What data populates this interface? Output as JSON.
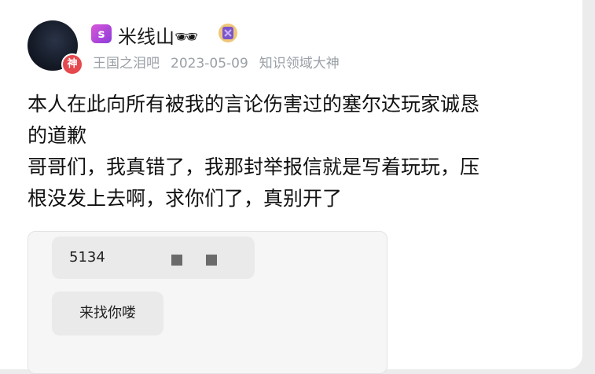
{
  "user": {
    "level": "s",
    "name": "米线山",
    "emoji": "🕶",
    "god_badge": "神"
  },
  "meta": {
    "forum": "王国之泪吧",
    "date": "2023-05-09",
    "title": "知识领域大神"
  },
  "post": {
    "line1": "本人在此向所有被我的言论伤害过的塞尔达玩家诚恳",
    "line2": "的道歉",
    "line3": "哥哥们，我真错了，我那封举报信就是写着玩玩，压",
    "line4": "根没发上去啊，求你们了，真别开了"
  },
  "embed": {
    "bubble1_text": "5134",
    "bubble2_text": "来找你喽"
  },
  "colors": {
    "god_badge": "#e5484d",
    "meta_text": "#9aa0a6",
    "level_badge": "#b548d9"
  }
}
